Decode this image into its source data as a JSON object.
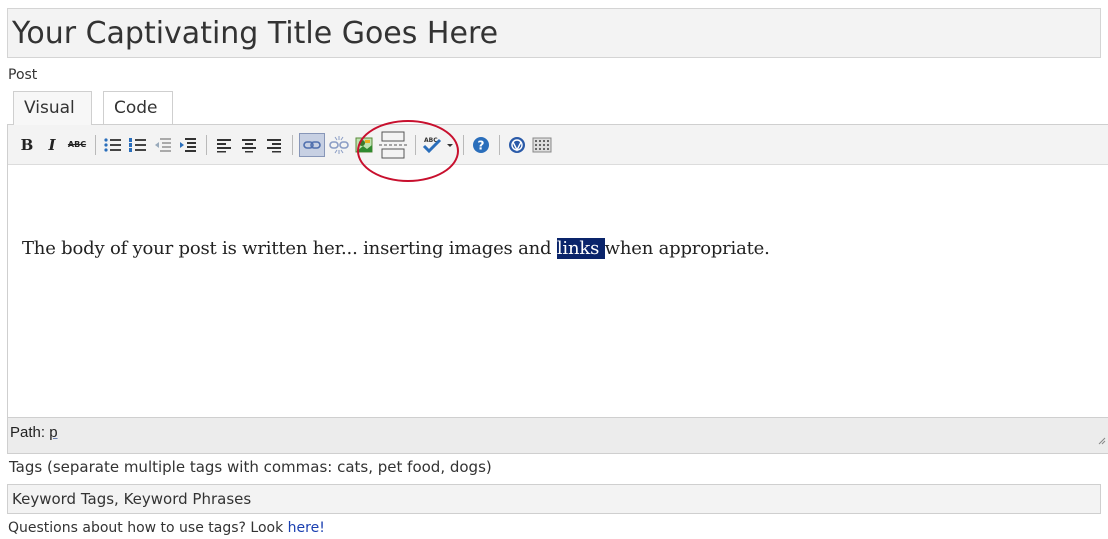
{
  "title_field": {
    "value": "Your Captivating Title Goes Here"
  },
  "post_label": "Post",
  "tabs": [
    {
      "label": "Visual",
      "active": true
    },
    {
      "label": "Code",
      "active": false
    }
  ],
  "toolbar": {
    "bold": "B",
    "italic": "I",
    "strike": "ABC",
    "icons": [
      "bold-icon",
      "italic-icon",
      "strikethrough-icon",
      "bullet-list-icon",
      "numbered-list-icon",
      "outdent-icon",
      "indent-icon",
      "align-left-icon",
      "align-center-icon",
      "align-right-icon",
      "link-icon",
      "unlink-icon",
      "insert-image-icon",
      "more-tag-icon",
      "spellcheck-icon",
      "help-icon",
      "wordpress-icon",
      "color-grid-icon"
    ],
    "active": "link-icon",
    "highlight_color": "#c8102e"
  },
  "content": {
    "before": "The body of your post is written her... inserting images and ",
    "selected": "links ",
    "after": "when appropriate."
  },
  "path": {
    "label": "Path: ",
    "value": "p"
  },
  "tags": {
    "label": "Tags (separate multiple tags with commas: cats, pet food, dogs)",
    "value": "Keyword Tags, Keyword Phrases"
  },
  "help": {
    "text": "Questions about how to use tags? Look ",
    "link": "here!"
  }
}
